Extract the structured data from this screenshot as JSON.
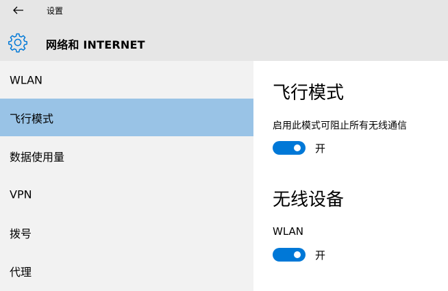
{
  "window": {
    "title": "设置"
  },
  "header": {
    "title": "网络和 INTERNET",
    "icon": "gear-icon"
  },
  "sidebar": {
    "items": [
      {
        "label": "WLAN",
        "selected": false
      },
      {
        "label": "飞行模式",
        "selected": true
      },
      {
        "label": "数据使用量",
        "selected": false
      },
      {
        "label": "VPN",
        "selected": false
      },
      {
        "label": "拨号",
        "selected": false
      },
      {
        "label": "代理",
        "selected": false
      }
    ]
  },
  "main": {
    "airplane": {
      "title": "飞行模式",
      "description": "启用此模式可阻止所有无线通信",
      "toggle_state": "开",
      "on": true
    },
    "wireless": {
      "title": "无线设备",
      "wlan_label": "WLAN",
      "toggle_state": "开",
      "on": true
    }
  },
  "colors": {
    "accent": "#0078d7",
    "selected_nav": "#99c3e6",
    "chrome_bg": "#e6e6e6",
    "sidebar_bg": "#f2f2f2",
    "content_bg": "#ffffff"
  }
}
